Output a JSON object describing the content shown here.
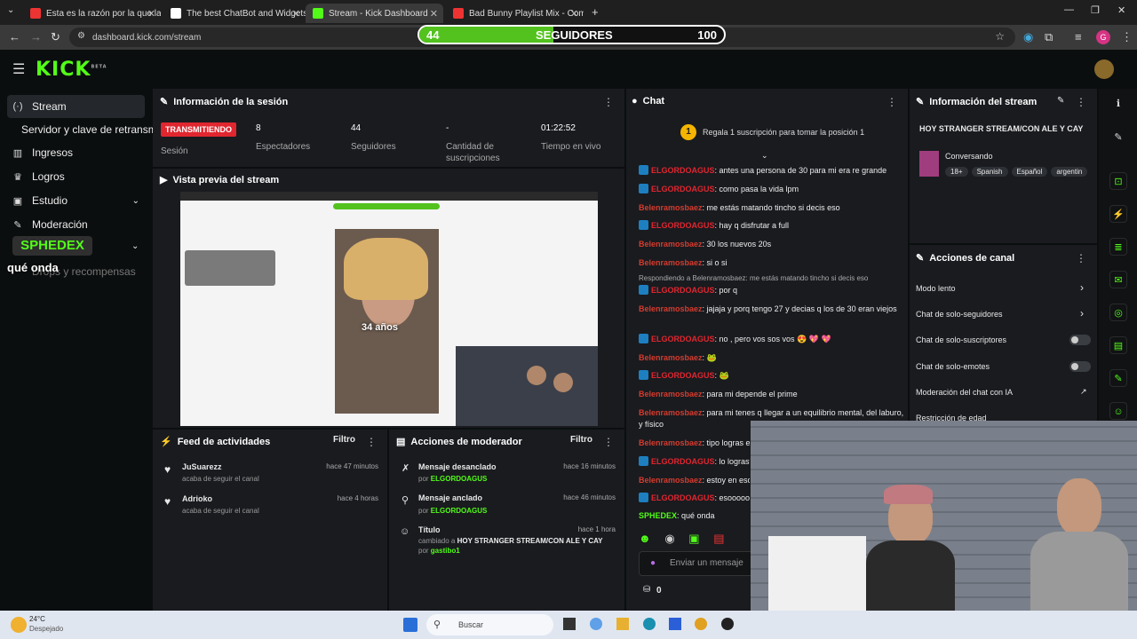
{
  "browser": {
    "tabs": [
      {
        "title": "Esta es la razón por la que las p",
        "color": "#e33"
      },
      {
        "title": "The best ChatBot and Widgets",
        "color": "#fff"
      },
      {
        "title": "Stream - Kick Dashboard",
        "color": "#53fc18"
      },
      {
        "title": "Bad Bunny Playlist Mix - Come",
        "color": "#e33"
      }
    ],
    "url": "dashboard.kick.com/stream"
  },
  "follow_goal": {
    "current": "44",
    "label": "SEGUIDORES",
    "target": "100",
    "progress": 0.44
  },
  "app": {
    "logo": "KICK",
    "logo_sup": "BETA"
  },
  "sidebar": {
    "items": [
      {
        "label": "Stream",
        "icon": "stream-icon"
      },
      {
        "label": "Servidor y clave de retransm",
        "icon": ""
      },
      {
        "label": "Ingresos",
        "icon": "chart-icon"
      },
      {
        "label": "Logros",
        "icon": "trophy-icon"
      },
      {
        "label": "Estudio",
        "icon": "studio-icon"
      },
      {
        "label": "Moderación",
        "icon": "wrench-icon"
      },
      {
        "label": "Drops y recompensas",
        "icon": "gift-icon"
      }
    ],
    "overlay_name": "SPHEDEX",
    "overlay_msg": "qué onda"
  },
  "session": {
    "title": "Información de la sesión",
    "status": "TRANSMITIENDO",
    "status_sub": "Sesión",
    "stats": [
      {
        "value": "8",
        "label": "Espectadores"
      },
      {
        "value": "44",
        "label": "Seguidores"
      },
      {
        "value": "-",
        "label": "Cantidad de suscripciones"
      },
      {
        "value": "01:22:52",
        "label": "Tiempo en vivo"
      }
    ]
  },
  "preview": {
    "title": "Vista previa del stream",
    "caption": "34 años"
  },
  "chat": {
    "title": "Chat",
    "gift_text": "Regala 1 suscripción para tomar la posición 1",
    "messages": [
      {
        "user": "ELGORDOAGUS",
        "text": ": antes una persona de 30 para mi era re grande",
        "badge": true,
        "c": "u1"
      },
      {
        "user": "ELGORDOAGUS",
        "text": ": como pasa la vida lpm",
        "badge": true,
        "c": "u1"
      },
      {
        "user": "Belenramosbaez",
        "text": ": me estás matando tincho si decis eso",
        "badge": false,
        "c": "u2"
      },
      {
        "user": "ELGORDOAGUS",
        "text": ": hay q disfrutar a full",
        "badge": true,
        "c": "u1"
      },
      {
        "user": "Belenramosbaez",
        "text": ": 30 los nuevos 20s",
        "badge": false,
        "c": "u2"
      },
      {
        "user": "Belenramosbaez",
        "text": ": si o si",
        "badge": false,
        "c": "u2"
      },
      {
        "user": "ELGORDOAGUS",
        "text": ": por q",
        "badge": true,
        "c": "u1"
      },
      {
        "user": "Belenramosbaez",
        "text": ": jajaja y porq tengo 27 y decias q los de 30 eran viejos",
        "badge": false,
        "c": "u2"
      },
      {
        "user": "ELGORDOAGUS",
        "text": ": no , pero vos sos vos 😍 💖 💖",
        "badge": true,
        "c": "u1"
      },
      {
        "user": "Belenramosbaez",
        "text": ": 🐸",
        "badge": false,
        "c": "u2"
      },
      {
        "user": "ELGORDOAGUS",
        "text": ": 🐸",
        "badge": true,
        "c": "u1"
      },
      {
        "user": "Belenramosbaez",
        "text": ": para mi depende el prime",
        "badge": false,
        "c": "u2"
      },
      {
        "user": "Belenramosbaez",
        "text": ": para mi tenes q llegar a un equilibrio mental, del laburo, y físico",
        "badge": false,
        "c": "u2"
      },
      {
        "user": "Belenramosbaez",
        "text": ": tipo logras e",
        "badge": false,
        "c": "u2"
      },
      {
        "user": "ELGORDOAGUS",
        "text": ": lo lograste",
        "badge": true,
        "c": "u1"
      },
      {
        "user": "Belenramosbaez",
        "text": ": estoy en eso",
        "badge": false,
        "c": "u2"
      },
      {
        "user": "ELGORDOAGUS",
        "text": ": esoooooo",
        "badge": true,
        "c": "u1"
      },
      {
        "user": "SPHEDEX",
        "text": ": qué onda",
        "badge": false,
        "c": "u3"
      }
    ],
    "reply_note": "Respondiendo a Belenramosbaez: me estás matando tincho si decis eso",
    "input_placeholder": "Enviar un mensaje",
    "viewer_count": "0"
  },
  "stream_info": {
    "title": "Información del stream",
    "stream_title": "HOY STRANGER STREAM/CON ALE Y CAY",
    "category": "Conversando",
    "tags": [
      "18+",
      "Spanish",
      "Español",
      "argentin"
    ]
  },
  "channel_actions": {
    "title": "Acciones de canal",
    "items": [
      {
        "label": "Modo lento",
        "kind": "arrow"
      },
      {
        "label": "Chat de solo-seguidores",
        "kind": "arrow"
      },
      {
        "label": "Chat de solo-suscriptores",
        "kind": "toggle"
      },
      {
        "label": "Chat de solo-emotes",
        "kind": "toggle"
      },
      {
        "label": "Moderación del chat con IA",
        "kind": "external"
      },
      {
        "label": "Restricción de edad",
        "kind": "arrow"
      }
    ]
  },
  "feed": {
    "title": "Feed de actividades",
    "filter": "Filtro",
    "items": [
      {
        "user": "JuSuarezz",
        "desc": "acaba de seguir el canal",
        "time": "hace 47 minutos"
      },
      {
        "user": "Adrioko",
        "desc": "acaba de seguir el canal",
        "time": "hace 4 horas"
      }
    ]
  },
  "mod_actions": {
    "title": "Acciones de moderador",
    "filter": "Filtro",
    "items": [
      {
        "action": "Mensaje desanclado",
        "by": "por",
        "mod": "ELGORDOAGUS",
        "time": "hace 16 minutos"
      },
      {
        "action": "Mensaje anclado",
        "by": "por",
        "mod": "ELGORDOAGUS",
        "time": "hace 46 minutos"
      },
      {
        "action": "Título",
        "by": "por",
        "mod": "gastibo1",
        "time": "hace 1 hora",
        "detail_prefix": "cambiado a",
        "detail": "HOY STRANGER STREAM/CON ALE Y CAY"
      }
    ]
  },
  "taskbar": {
    "temp": "24°C",
    "weather": "Despejado",
    "search": "Buscar"
  }
}
